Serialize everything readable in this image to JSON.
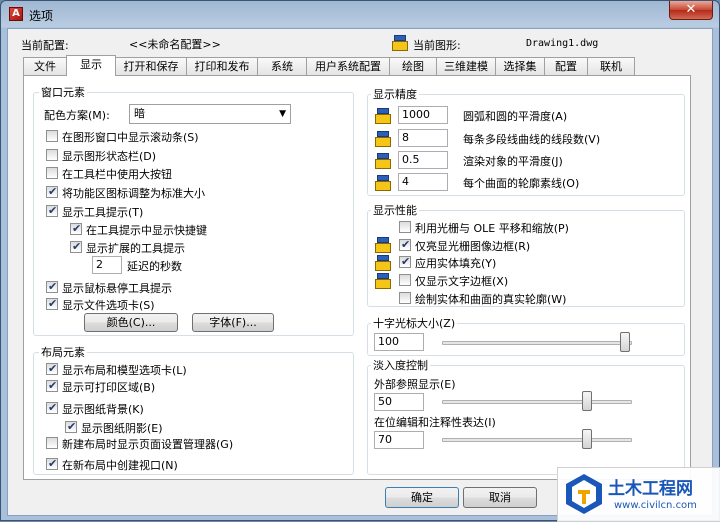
{
  "window": {
    "title": "选项",
    "close_glyph": "✕"
  },
  "profile": {
    "current_profile_label": "当前配置:",
    "current_profile_value": "<<未命名配置>>",
    "current_drawing_label": "当前图形:",
    "current_drawing_value": "Drawing1.dwg"
  },
  "tabs": [
    {
      "label": "文件"
    },
    {
      "label": "显示",
      "active": true
    },
    {
      "label": "打开和保存"
    },
    {
      "label": "打印和发布"
    },
    {
      "label": "系统"
    },
    {
      "label": "用户系统配置"
    },
    {
      "label": "绘图"
    },
    {
      "label": "三维建模"
    },
    {
      "label": "选择集"
    },
    {
      "label": "配置"
    },
    {
      "label": "联机"
    }
  ],
  "window_elements": {
    "title": "窗口元素",
    "color_scheme_label": "配色方案(M):",
    "color_scheme_value": "暗",
    "items": [
      {
        "label": "在图形窗口中显示滚动条(S)",
        "checked": false
      },
      {
        "label": "显示图形状态栏(D)",
        "checked": false
      },
      {
        "label": "在工具栏中使用大按钮",
        "checked": false
      },
      {
        "label": "将功能区图标调整为标准大小",
        "checked": true
      },
      {
        "label": "显示工具提示(T)",
        "checked": true
      },
      {
        "label": "在工具提示中显示快捷键",
        "checked": true
      },
      {
        "label": "显示扩展的工具提示",
        "checked": true
      },
      {
        "label": "显示鼠标悬停工具提示",
        "checked": true
      },
      {
        "label": "显示文件选项卡(S)",
        "checked": true
      }
    ],
    "delay_value": "2",
    "delay_label": "延迟的秒数",
    "colors_button": "颜色(C)...",
    "fonts_button": "字体(F)..."
  },
  "layout_elements": {
    "title": "布局元素",
    "items": [
      {
        "label": "显示布局和模型选项卡(L)",
        "checked": true
      },
      {
        "label": "显示可打印区域(B)",
        "checked": true
      },
      {
        "label": "显示图纸背景(K)",
        "checked": true
      },
      {
        "label": "显示图纸阴影(E)",
        "checked": true
      },
      {
        "label": "新建布局时显示页面设置管理器(G)",
        "checked": false
      },
      {
        "label": "在新布局中创建视口(N)",
        "checked": true
      }
    ]
  },
  "display_resolution": {
    "title": "显示精度",
    "items": [
      {
        "value": "1000",
        "label": "圆弧和圆的平滑度(A)"
      },
      {
        "value": "8",
        "label": "每条多段线曲线的线段数(V)"
      },
      {
        "value": "0.5",
        "label": "渲染对象的平滑度(J)"
      },
      {
        "value": "4",
        "label": "每个曲面的轮廓素线(O)"
      }
    ]
  },
  "display_performance": {
    "title": "显示性能",
    "items": [
      {
        "label": "利用光栅与 OLE 平移和缩放(P)",
        "checked": false,
        "icon": false
      },
      {
        "label": "仅亮显光栅图像边框(R)",
        "checked": true,
        "icon": true
      },
      {
        "label": "应用实体填充(Y)",
        "checked": true,
        "icon": true
      },
      {
        "label": "仅显示文字边框(X)",
        "checked": false,
        "icon": true
      },
      {
        "label": "绘制实体和曲面的真实轮廓(W)",
        "checked": false,
        "icon": false
      }
    ]
  },
  "crosshair": {
    "title": "十字光标大小(Z)",
    "value": "100",
    "level_percent": 100
  },
  "fade_control": {
    "title": "淡入度控制",
    "xref_label": "外部参照显示(E)",
    "xref_value": "50",
    "inplace_label": "在位编辑和注释性表达(I)",
    "inplace_value": "70"
  },
  "footer": {
    "ok": "确定",
    "cancel": "取消"
  },
  "watermark": {
    "name": "土木工程网",
    "url": "www.civilcn.com"
  },
  "colors": {
    "accent": "#1a57b8",
    "title_bar": "#b9cde2"
  }
}
